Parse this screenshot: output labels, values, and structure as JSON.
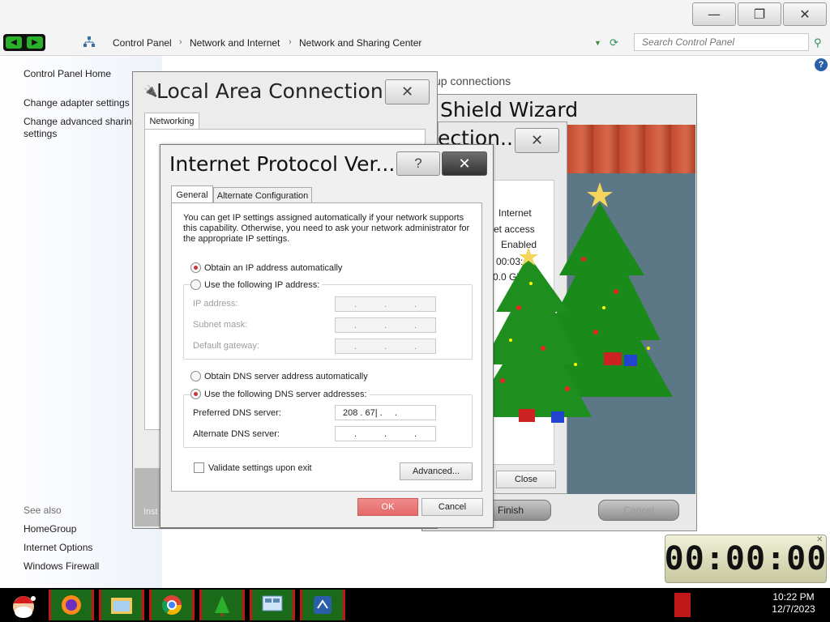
{
  "window": {
    "minimize": "—",
    "maximize": "❐",
    "close": "✕"
  },
  "address_bar": {
    "crumbs": [
      "Control Panel",
      "Network and Internet",
      "Network and Sharing Center"
    ],
    "search_placeholder": "Search Control Panel"
  },
  "left_pane": {
    "home": "Control Panel Home",
    "change_adapter": "Change adapter settings",
    "change_sharing_1": "Change advanced sharing",
    "change_sharing_2": "settings",
    "see_also": "See also",
    "homegroup": "HomeGroup",
    "internet_options": "Internet Options",
    "windows_firewall": "Windows Firewall"
  },
  "main": {
    "heading_fragment": "up connections"
  },
  "wizard": {
    "title": "Shield Wizard",
    "finish": "Finish",
    "cancel": "Cancel",
    "inst_fragment": "Inst"
  },
  "status_dialog": {
    "title": "ection...",
    "values": [
      "Internet",
      "et access",
      "Enabled",
      "00:03:",
      "0.0 Gb"
    ],
    "close": "Close"
  },
  "lac_dialog": {
    "title": "Local Area Connection...",
    "tab_networking": "Networking",
    "close": "✕"
  },
  "ipv4_dialog": {
    "title": "Internet Protocol Ver...",
    "help": "?",
    "close": "✕",
    "tab_general": "General",
    "tab_alternate": "Alternate Configuration",
    "description": "You can get IP settings assigned automatically if your network supports this capability. Otherwise, you need to ask your network administrator for the appropriate IP settings.",
    "radio_obtain_ip": "Obtain an IP address automatically",
    "radio_use_ip": "Use the following IP address:",
    "ip_address_label": "IP address:",
    "subnet_label": "Subnet mask:",
    "gateway_label": "Default gateway:",
    "radio_obtain_dns": "Obtain DNS server address automatically",
    "radio_use_dns": "Use the following DNS server addresses:",
    "preferred_dns_label": "Preferred DNS server:",
    "preferred_dns_value": "208 . 67| .     .",
    "alternate_dns_label": "Alternate DNS server:",
    "validate_label": "Validate settings upon exit",
    "advanced": "Advanced...",
    "ok": "OK",
    "cancel": "Cancel"
  },
  "timer": {
    "display": "00:00:00"
  },
  "taskbar": {
    "time": "10:22 PM",
    "date": "12/7/2023"
  }
}
